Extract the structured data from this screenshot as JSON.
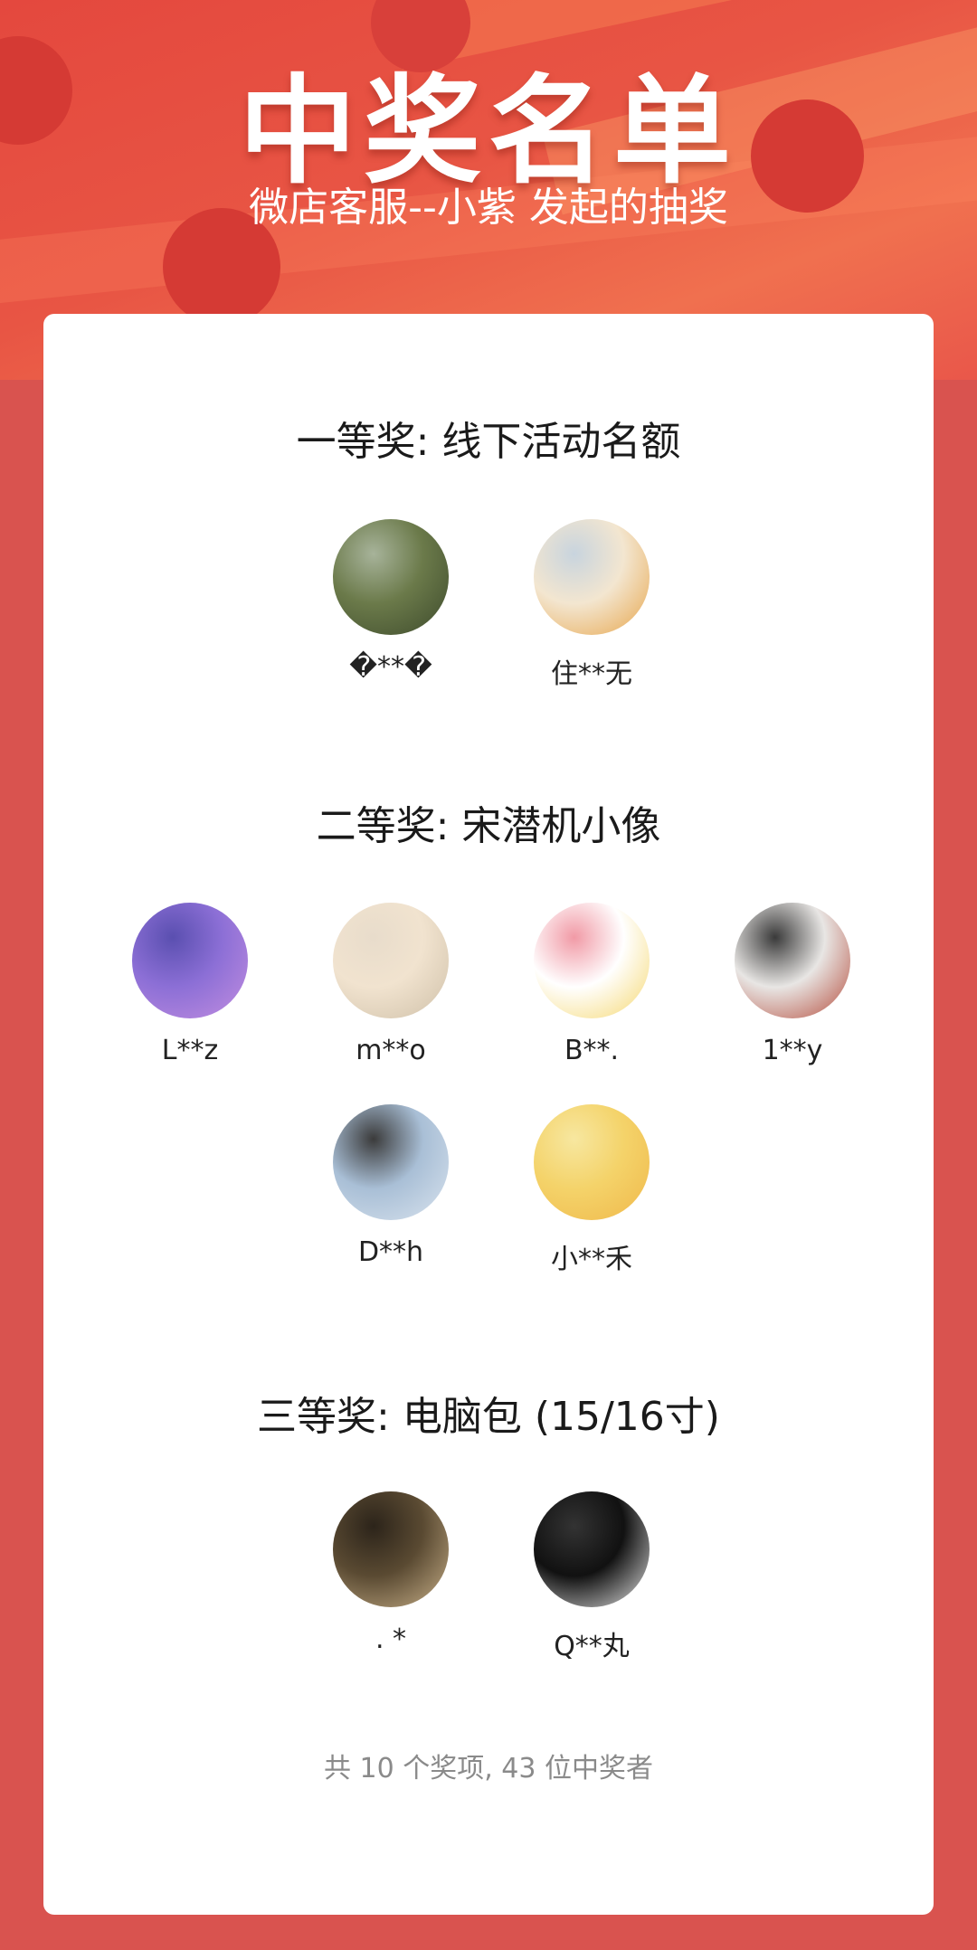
{
  "header": {
    "title": "中奖名单",
    "subtitle": "微店客服--小紫 发起的抽奖"
  },
  "prizes": [
    {
      "title": "一等奖: 线下活动名额",
      "winners": [
        {
          "name": "�**�",
          "avatar_colors": [
            "#6b7a4a",
            "#3d4a2c",
            "#a7b39a"
          ]
        },
        {
          "name": "住**无",
          "avatar_colors": [
            "#f3e6d0",
            "#e7a54a",
            "#c8d4de"
          ]
        }
      ]
    },
    {
      "title": "二等奖: 宋潜机小像",
      "winners": [
        {
          "name": "L**z",
          "avatar_colors": [
            "#8c6fd6",
            "#c38ee0",
            "#5a4fb0"
          ]
        },
        {
          "name": "m**o",
          "avatar_colors": [
            "#f1e3cf",
            "#cfc0a8",
            "#e8dccb"
          ]
        },
        {
          "name": "B**.",
          "avatar_colors": [
            "#ffffff",
            "#f5d76e",
            "#f19aa6"
          ]
        },
        {
          "name": "1**y",
          "avatar_colors": [
            "#e8e6e4",
            "#b44a3a",
            "#3a3a3a"
          ]
        },
        {
          "name": "D**h",
          "avatar_colors": [
            "#a9bfd6",
            "#d9e3ee",
            "#3b3b3b"
          ]
        },
        {
          "name": "小**禾",
          "avatar_colors": [
            "#f4d36a",
            "#f0b84a",
            "#f7e7a0"
          ]
        }
      ]
    },
    {
      "title": "三等奖: 电脑包 (15/16寸)",
      "winners": [
        {
          "name": ". *",
          "avatar_colors": [
            "#5a4a32",
            "#c8b089",
            "#2c241a"
          ]
        },
        {
          "name": "Q**丸",
          "avatar_colors": [
            "#111111",
            "#e6e6e6",
            "#333333"
          ]
        }
      ]
    }
  ],
  "footer": "共 10 个奖项, 43 位中奖者"
}
